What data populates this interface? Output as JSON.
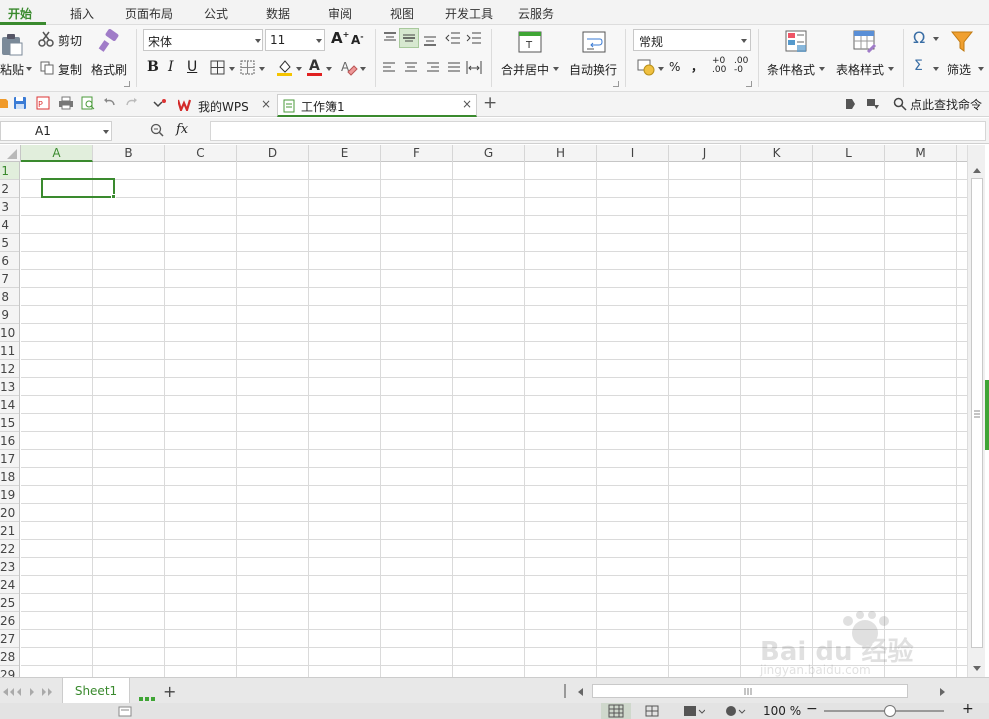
{
  "menu": {
    "items": [
      "开始",
      "插入",
      "页面布局",
      "公式",
      "数据",
      "审阅",
      "视图",
      "开发工具",
      "云服务"
    ]
  },
  "ribbon": {
    "paste": "粘贴",
    "cut": "剪切",
    "copy": "复制",
    "format_painter": "格式刷",
    "font_name": "宋体",
    "font_size": "11",
    "merge_center": "合并居中",
    "wrap_text": "自动换行",
    "number_format": "常规",
    "percent": "%",
    "comma": "，",
    "conditional_format": "条件格式",
    "table_style": "表格样式",
    "filter": "筛选",
    "omega": "Ω",
    "sigma": "Σ"
  },
  "tabs": {
    "wps_tab": "我的WPS",
    "workbook_tab": "工作簿1",
    "close": "×",
    "add": "+",
    "command_search": "点此查找命令"
  },
  "formula_bar": {
    "name_box": "A1",
    "fx": "fx",
    "formula": ""
  },
  "grid": {
    "columns": [
      "A",
      "B",
      "C",
      "D",
      "E",
      "F",
      "G",
      "H",
      "I",
      "J",
      "K",
      "L",
      "M"
    ],
    "rows": [
      "1",
      "2",
      "3",
      "4",
      "5",
      "6",
      "7",
      "8",
      "9",
      "10",
      "11",
      "12",
      "13",
      "14",
      "15",
      "16",
      "17",
      "18",
      "19",
      "20",
      "21",
      "22",
      "23",
      "24",
      "25",
      "26",
      "27",
      "28",
      "29"
    ],
    "selected_cell": "A1"
  },
  "sheets": {
    "active": "Sheet1",
    "add": "+"
  },
  "status": {
    "zoom": "100 %"
  },
  "colors": {
    "accent": "#3a8a2e",
    "scroll_edge": "#3fa535"
  },
  "watermark": {
    "brand": "Bai du 经验",
    "url": "jingyan.baidu.com"
  }
}
